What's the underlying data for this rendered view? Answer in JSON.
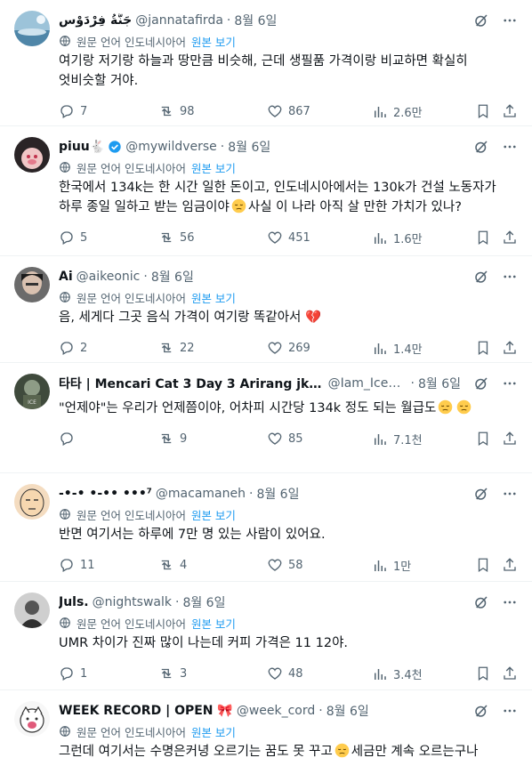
{
  "translation": {
    "label": "원문 언어 인도네시아어",
    "show_original": "원본 보기"
  },
  "tweets": [
    {
      "name": "جَنَّةُ فِرْدَوْسِ",
      "handle": "@jannatafirda",
      "date": "8월 6일",
      "text": "여기랑 저기랑 하늘과 땅만큼 비슷해, 근데 생필품 가격이랑 비교하면 확실히 엇비슷할 거야.",
      "replies": "7",
      "retweets": "98",
      "likes": "867",
      "views": "2.6만",
      "verified": false
    },
    {
      "name": "piuu🐇",
      "handle": "@mywildverse",
      "date": "8월 6일",
      "text_before": "한국에서 134k는 한 시간 일한 돈이고, 인도네시아에서는 130k가 건설 노동자가 하루 종일 일하고 받는 임금이야",
      "text_after": "사실 이 나라 아직 살 만한 가치가 있나?",
      "replies": "5",
      "retweets": "56",
      "likes": "451",
      "views": "1.6만",
      "verified": true
    },
    {
      "name": "Ai",
      "handle": "@aikeonic",
      "date": "8월 6일",
      "text": "음, 세게다 그곳 음식 가격이 여기랑 똑같아서 💔",
      "replies": "2",
      "retweets": "22",
      "likes": "269",
      "views": "1.4만",
      "verified": false
    },
    {
      "name": "타타 | Mencari Cat 3 Day 3 Arirang jkt 🔍 ...",
      "handle": "@Iam_Icebe...",
      "date": "8월 6일",
      "text": "\"언제야\"는 우리가 언제쯤이야, 어차피 시간당 134k 정도 되는 월급도",
      "replies": "",
      "retweets": "9",
      "likes": "85",
      "views": "7.1천",
      "verified": false
    },
    {
      "name": "-•-• •-•• •••⁷",
      "handle": "@macamaneh",
      "date": "8월 6일",
      "text": "반면 여기서는 하루에 7만 명 있는 사람이 있어요.",
      "replies": "11",
      "retweets": "4",
      "likes": "58",
      "views": "1만",
      "verified": false
    },
    {
      "name": "Juls.",
      "handle": "@nightswalk",
      "date": "8월 6일",
      "text": "UMR 차이가 진짜 많이 나는데 커피 가격은 11 12야.",
      "replies": "1",
      "retweets": "3",
      "likes": "48",
      "views": "3.4천",
      "verified": false
    },
    {
      "name": "WEEK RECORD | OPEN 🎀",
      "handle": "@week_cord",
      "date": "8월 6일",
      "text_before": "그런데 여기서는 수명은커녕 오르기는 꿈도 못 꾸고",
      "text_after": "세금만 계속 오르는구나",
      "replies": "",
      "retweets": "",
      "likes": "",
      "views": "",
      "verified": false
    }
  ],
  "colors": {
    "text": "#0f1419",
    "muted": "#536471",
    "link": "#1d9bf0",
    "border": "#eff3f4",
    "heart_break": "#e0245e"
  },
  "icons": [
    "grok-icon",
    "more-icon",
    "globe-icon",
    "reply-icon",
    "retweet-icon",
    "like-icon",
    "views-icon",
    "bookmark-icon",
    "share-icon",
    "verified-badge-icon",
    "emoji-pensive-icon"
  ]
}
